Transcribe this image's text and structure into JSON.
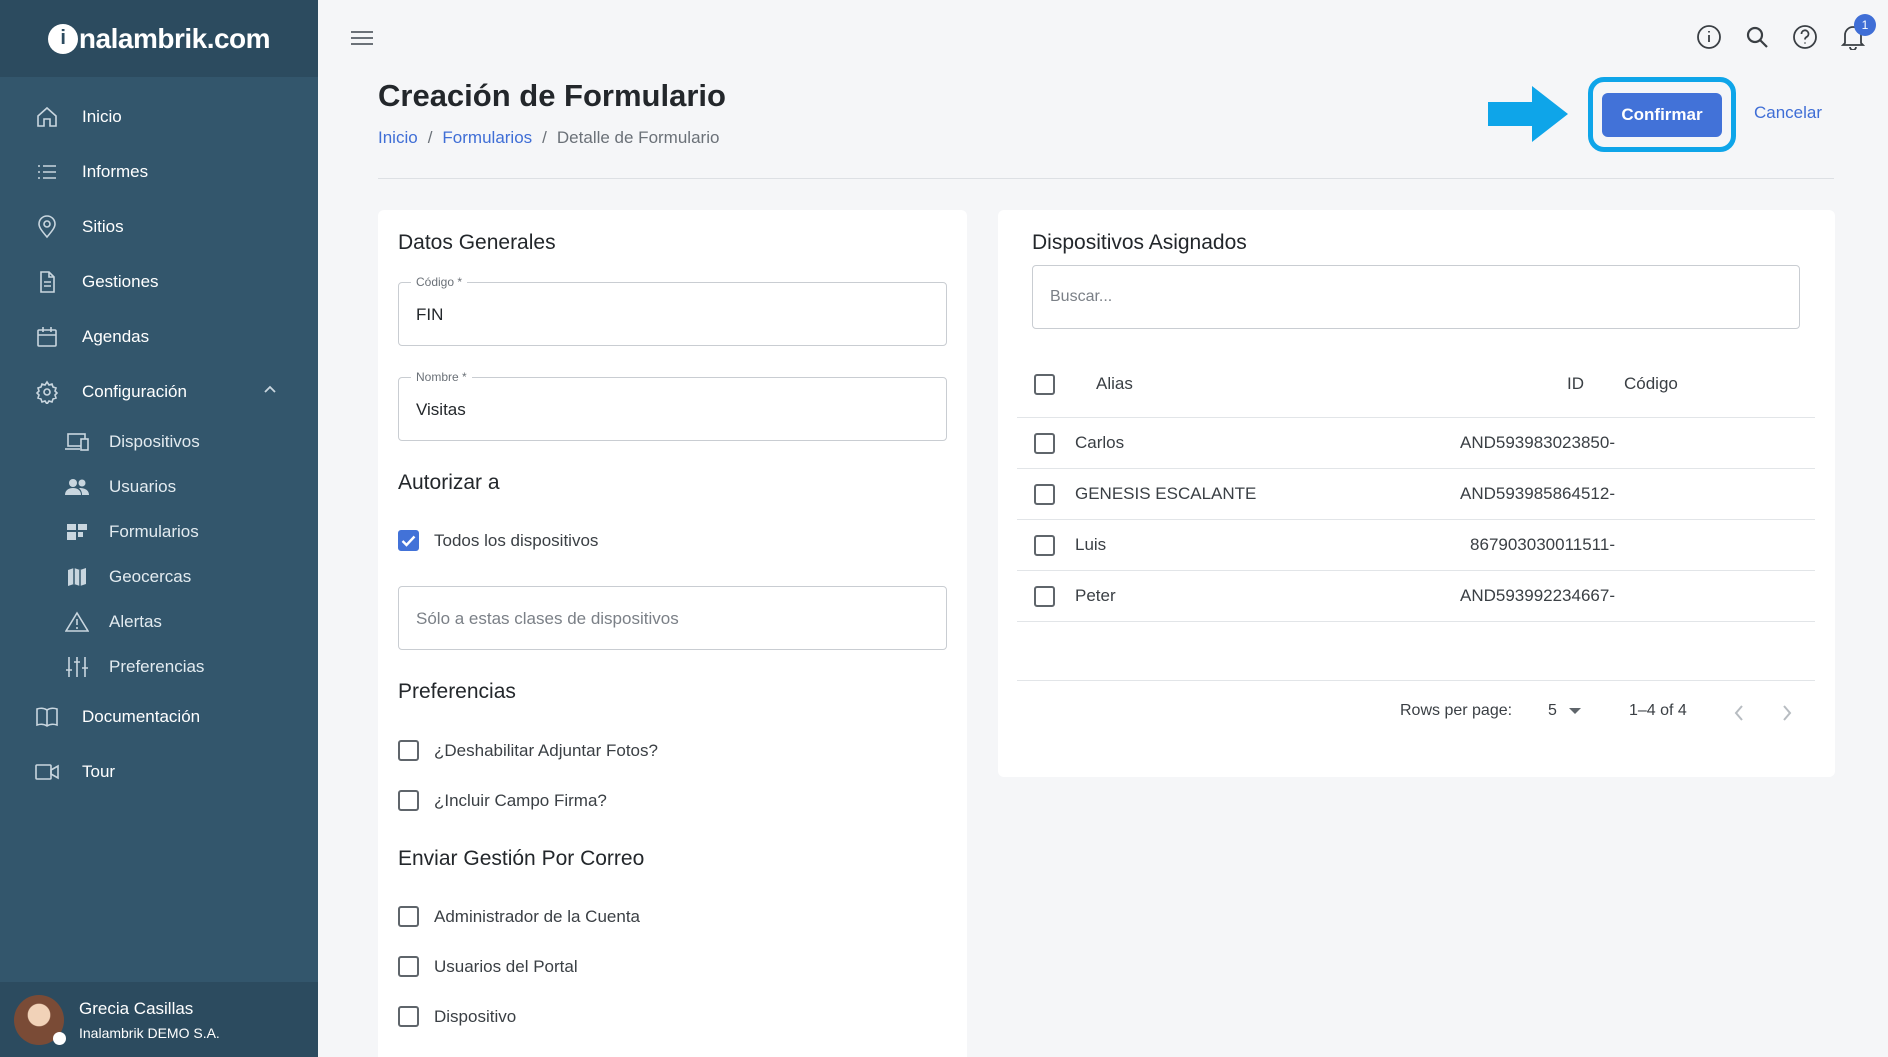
{
  "brand": {
    "logo_letter": "i",
    "logo_text": "nalambrik.com"
  },
  "sidebar": {
    "items": [
      {
        "label": "Inicio",
        "icon": "home-icon"
      },
      {
        "label": "Informes",
        "icon": "list-icon"
      },
      {
        "label": "Sitios",
        "icon": "location-pin-icon"
      },
      {
        "label": "Gestiones",
        "icon": "document-icon"
      },
      {
        "label": "Agendas",
        "icon": "calendar-icon"
      },
      {
        "label": "Configuración",
        "icon": "gear-icon"
      }
    ],
    "sub_items": [
      {
        "label": "Dispositivos",
        "icon": "devices-icon"
      },
      {
        "label": "Usuarios",
        "icon": "users-icon"
      },
      {
        "label": "Formularios",
        "icon": "forms-icon"
      },
      {
        "label": "Geocercas",
        "icon": "map-icon"
      },
      {
        "label": "Alertas",
        "icon": "warning-icon"
      },
      {
        "label": "Preferencias",
        "icon": "sliders-icon"
      }
    ],
    "bottom_items": [
      {
        "label": "Documentación",
        "icon": "book-icon"
      },
      {
        "label": "Tour",
        "icon": "video-icon"
      }
    ]
  },
  "user": {
    "name": "Grecia Casillas",
    "org": "Inalambrik DEMO S.A."
  },
  "topbar": {
    "notifications_count": "1"
  },
  "header": {
    "title": "Creación de Formulario",
    "breadcrumb": [
      "Inicio",
      "Formularios",
      "Detalle de Formulario"
    ],
    "separator": "/",
    "confirm_label": "Confirmar",
    "cancel_label": "Cancelar"
  },
  "general": {
    "title": "Datos Generales",
    "code_label": "Código *",
    "code_value": "FIN",
    "name_label": "Nombre *",
    "name_value": "Visitas"
  },
  "authorize": {
    "title": "Autorizar a",
    "all_devices_label": "Todos los dispositivos",
    "all_devices_checked": true,
    "classes_placeholder": "Sólo a estas clases de dispositivos"
  },
  "preferences": {
    "title": "Preferencias",
    "options": [
      "¿Deshabilitar Adjuntar Fotos?",
      "¿Incluir Campo Firma?"
    ]
  },
  "email": {
    "title": "Enviar Gestión Por Correo",
    "options": [
      "Administrador de la Cuenta",
      "Usuarios del Portal",
      "Dispositivo"
    ]
  },
  "devices": {
    "title": "Dispositivos Asignados",
    "search_placeholder": "Buscar...",
    "columns": [
      "Alias",
      "ID",
      "Código"
    ],
    "rows": [
      {
        "alias": "Carlos",
        "id": "AND593983023850-",
        "code": ""
      },
      {
        "alias": "GENESIS ESCALANTE",
        "id": "AND593985864512-",
        "code": ""
      },
      {
        "alias": "Luis",
        "id": "867903030011511-",
        "code": ""
      },
      {
        "alias": "Peter",
        "id": "AND593992234667-",
        "code": ""
      }
    ],
    "rows_per_page_label": "Rows per page:",
    "rows_per_page": "5",
    "range": "1–4 of 4"
  },
  "colors": {
    "sidebar": "#33566c",
    "accent": "#4272d8",
    "highlight": "#0ea5e9"
  }
}
